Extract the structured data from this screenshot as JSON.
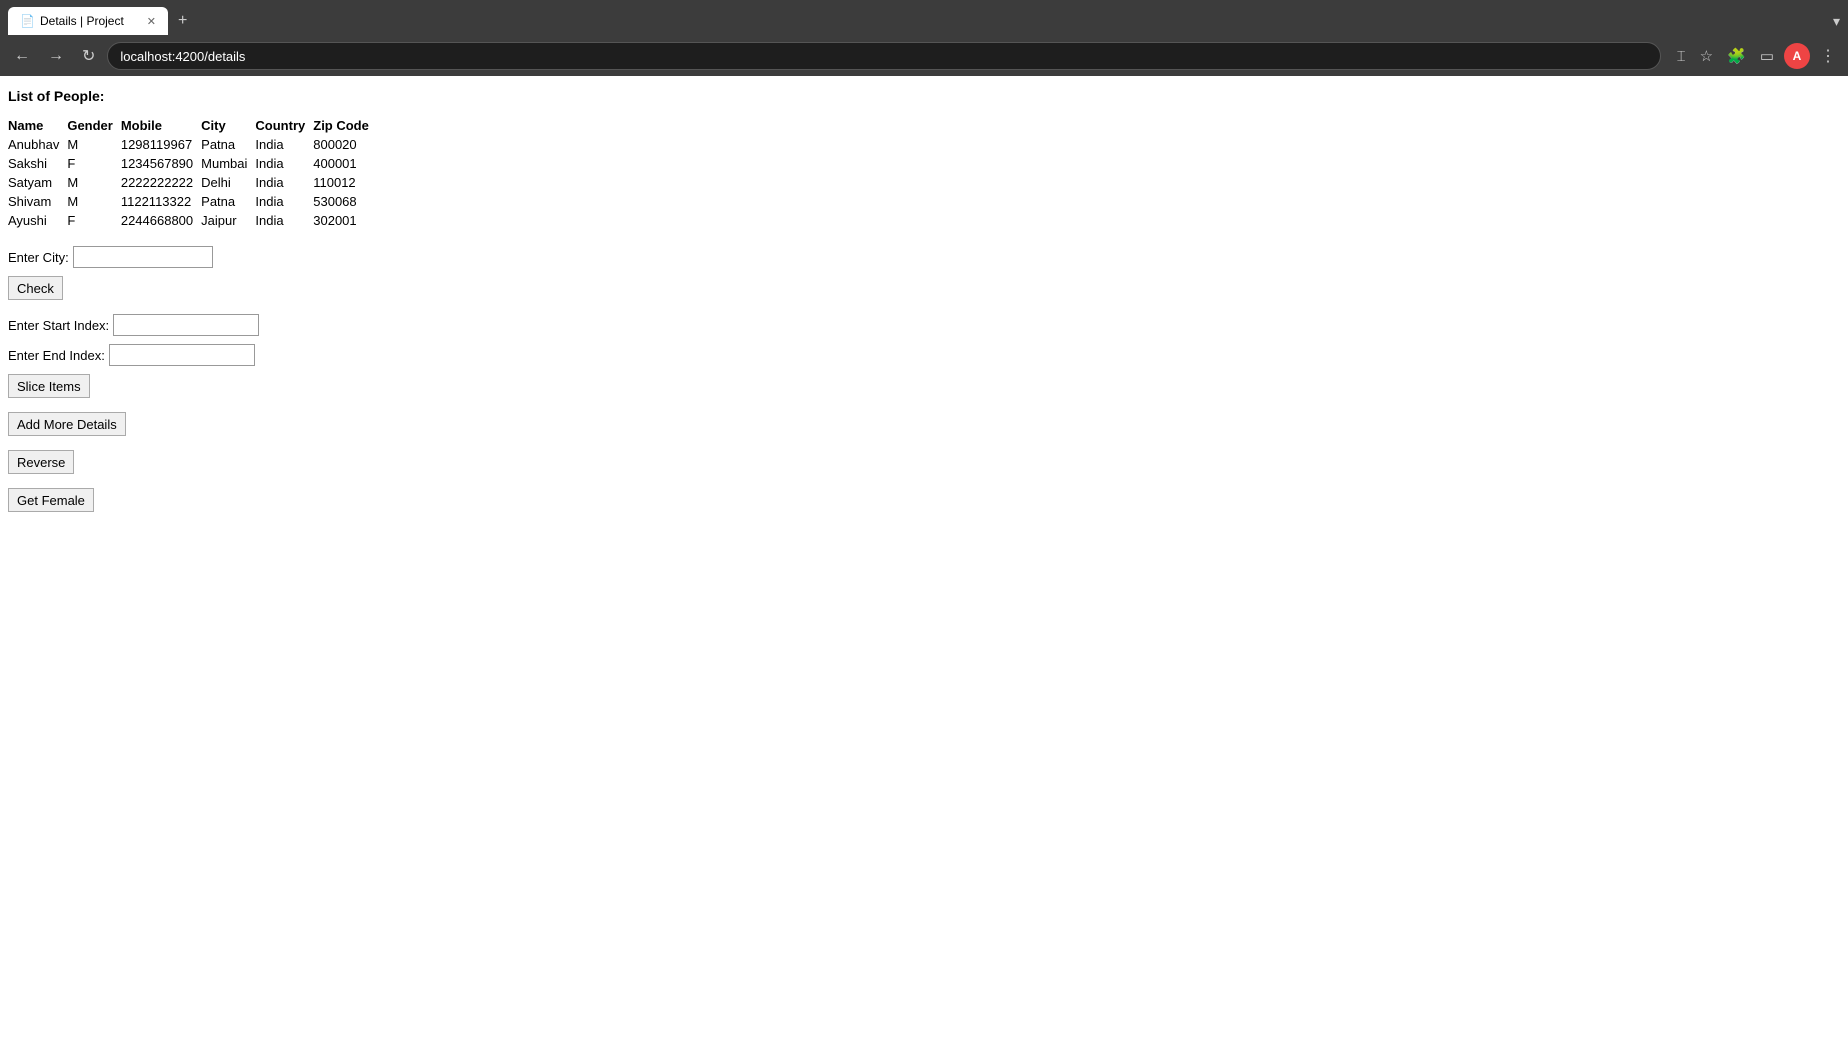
{
  "browser": {
    "tab_title": "Details | Project",
    "tab_favicon": "📄",
    "new_tab_label": "+",
    "address": "localhost:4200/details",
    "overflow_icon": "▾"
  },
  "page": {
    "title": "List of People:",
    "table": {
      "headers": [
        "Name",
        "Gender",
        "Mobile",
        "City",
        "Country",
        "Zip Code"
      ],
      "rows": [
        [
          "Anubhav",
          "M",
          "1298119967",
          "Patna",
          "India",
          "800020"
        ],
        [
          "Sakshi",
          "F",
          "1234567890",
          "Mumbai",
          "India",
          "400001"
        ],
        [
          "Satyam",
          "M",
          "2222222222",
          "Delhi",
          "India",
          "110012"
        ],
        [
          "Shivam",
          "M",
          "1122113322",
          "Patna",
          "India",
          "530068"
        ],
        [
          "Ayushi",
          "F",
          "2244668800",
          "Jaipur",
          "India",
          "302001"
        ]
      ]
    },
    "city_label": "Enter City:",
    "city_placeholder": "",
    "check_button": "Check",
    "start_index_label": "Enter Start Index:",
    "start_index_placeholder": "",
    "end_index_label": "Enter End Index:",
    "end_index_placeholder": "",
    "slice_button": "Slice Items",
    "add_more_button": "Add More Details",
    "reverse_button": "Reverse",
    "get_female_button": "Get Female"
  }
}
